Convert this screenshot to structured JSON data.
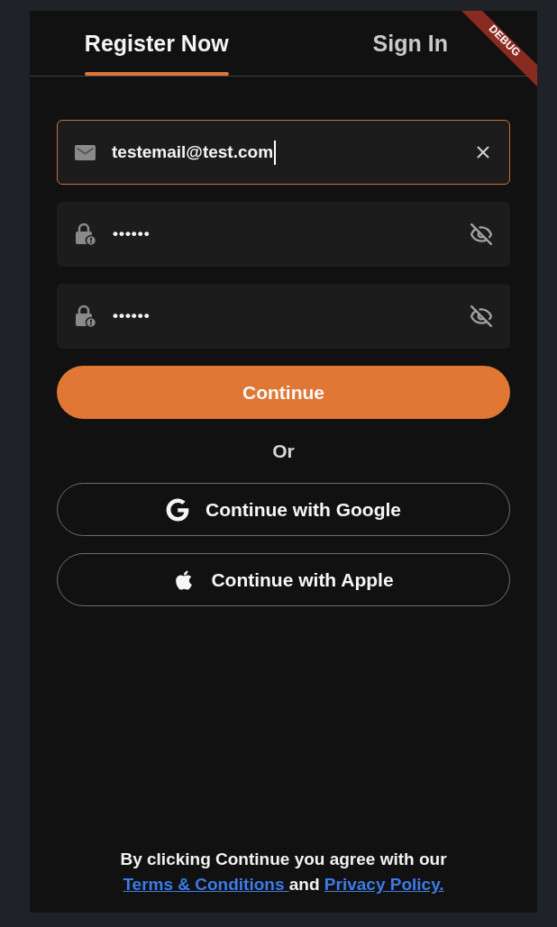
{
  "tabs": [
    {
      "label": "Register Now",
      "selected": true
    },
    {
      "label": "Sign In",
      "selected": false
    }
  ],
  "debug_banner": {
    "label": "DEBUG"
  },
  "fields": [
    {
      "kind": "email",
      "value": "testemail@test.com",
      "focused": true
    },
    {
      "kind": "password",
      "value": "••••••",
      "focused": false,
      "obscured": true
    },
    {
      "kind": "password",
      "value": "••••••",
      "focused": false,
      "obscured": true
    }
  ],
  "primary_button": {
    "label": "Continue"
  },
  "separator": {
    "label": "Or"
  },
  "social_buttons": [
    {
      "kind": "google",
      "label": "Continue with Google"
    },
    {
      "kind": "apple",
      "label": "Continue with Apple"
    }
  ],
  "legal": {
    "lines": [
      [
        {
          "kind": "text",
          "text": "By clicking Continue you agree with our"
        }
      ],
      [
        {
          "kind": "link",
          "text": "Terms & Conditions "
        },
        {
          "kind": "text",
          "text": "and "
        },
        {
          "kind": "link",
          "text": "Privacy Policy."
        }
      ]
    ]
  }
}
